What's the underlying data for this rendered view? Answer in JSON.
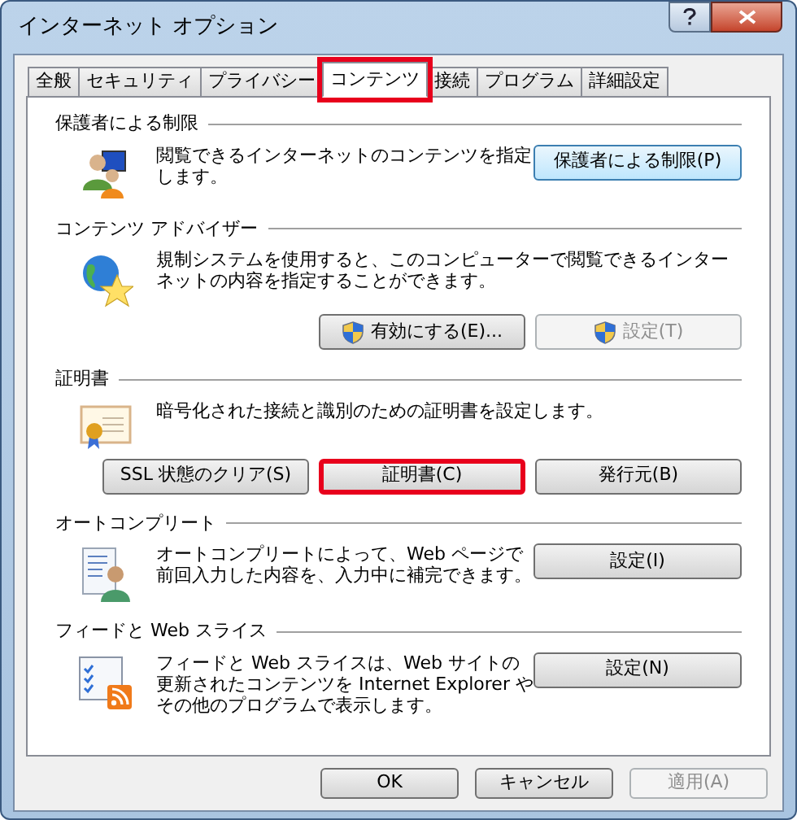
{
  "window": {
    "title": "インターネット オプション"
  },
  "tabs": [
    {
      "label": "全般",
      "selected": false,
      "highlighted": false
    },
    {
      "label": "セキュリティ",
      "selected": false,
      "highlighted": false
    },
    {
      "label": "プライバシー",
      "selected": false,
      "highlighted": false
    },
    {
      "label": "コンテンツ",
      "selected": true,
      "highlighted": true
    },
    {
      "label": "接続",
      "selected": false,
      "highlighted": false
    },
    {
      "label": "プログラム",
      "selected": false,
      "highlighted": false
    },
    {
      "label": "詳細設定",
      "selected": false,
      "highlighted": false
    }
  ],
  "sections": [
    {
      "heading": "保護者による制限",
      "kind": "side",
      "description": "閲覧できるインターネットのコンテンツを指定します。",
      "buttons": [
        {
          "label": "保護者による制限(P)",
          "disabled": false,
          "shield": false,
          "highlighted": false,
          "focused": true
        }
      ]
    },
    {
      "heading": "コンテンツ アドバイザー",
      "kind": "below",
      "description": "規制システムを使用すると、このコンピューターで閲覧できるインターネットの内容を指定することができます。",
      "buttons": [
        {
          "label": "有効にする(E)...",
          "disabled": false,
          "shield": true,
          "highlighted": false,
          "focused": false
        },
        {
          "label": "設定(T)",
          "disabled": true,
          "shield": true,
          "highlighted": false,
          "focused": false
        }
      ]
    },
    {
      "heading": "証明書",
      "kind": "below",
      "description": "暗号化された接続と識別のための証明書を設定します。",
      "buttons": [
        {
          "label": "SSL 状態のクリア(S)",
          "disabled": false,
          "shield": false,
          "highlighted": false,
          "focused": false
        },
        {
          "label": "証明書(C)",
          "disabled": false,
          "shield": false,
          "highlighted": true,
          "focused": false
        },
        {
          "label": "発行元(B)",
          "disabled": false,
          "shield": false,
          "highlighted": false,
          "focused": false
        }
      ]
    },
    {
      "heading": "オートコンプリート",
      "kind": "side",
      "description": "オートコンプリートによって、Web ページで前回入力した内容を、入力中に補完できます。",
      "buttons": [
        {
          "label": "設定(I)",
          "disabled": false,
          "shield": false,
          "highlighted": false,
          "focused": false
        }
      ]
    },
    {
      "heading": "フィードと Web スライス",
      "kind": "side",
      "description": "フィードと Web スライスは、Web サイトの更新されたコンテンツを Internet Explorer やその他のプログラムで表示します。",
      "buttons": [
        {
          "label": "設定(N)",
          "disabled": false,
          "shield": false,
          "highlighted": false,
          "focused": false
        }
      ]
    }
  ],
  "footer_buttons": [
    {
      "label": "OK",
      "disabled": false
    },
    {
      "label": "キャンセル",
      "disabled": false
    },
    {
      "label": "適用(A)",
      "disabled": true
    }
  ]
}
